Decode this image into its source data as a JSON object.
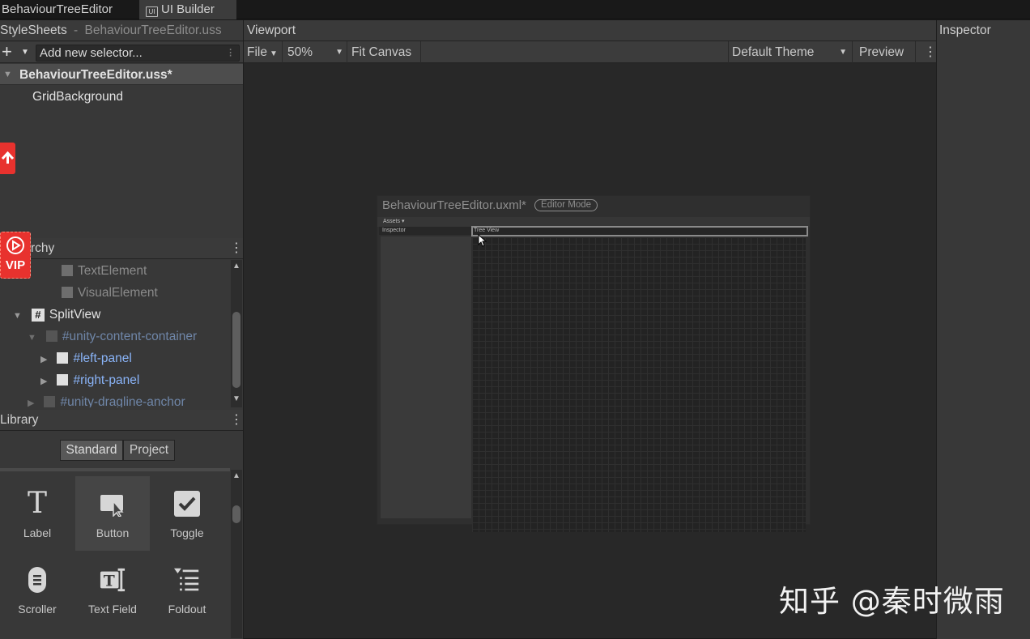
{
  "tabs": [
    {
      "label": "BehaviourTreeEditor"
    },
    {
      "label": "UI Builder",
      "icon": "ui-builder-icon",
      "icon_text": "UI"
    }
  ],
  "stylesheets": {
    "header_title": "StyleSheets",
    "header_sep": "-",
    "header_file": "BehaviourTreeEditor.uss",
    "add_glyph": "+",
    "selector_placeholder": "Add new selector...",
    "selector_menu": "⁝",
    "items": [
      {
        "label": "BehaviourTreeEditor.uss*"
      },
      {
        "label": "GridBackground"
      }
    ]
  },
  "hierarchy": {
    "title_visible": "rchy",
    "rows": [
      {
        "label": "TextElement"
      },
      {
        "label": "VisualElement"
      },
      {
        "label": "SplitView",
        "badge": "#"
      },
      {
        "label": "#unity-content-container"
      },
      {
        "label": "#left-panel"
      },
      {
        "label": "#right-panel"
      },
      {
        "label": "#unity-dragline-anchor"
      }
    ]
  },
  "library": {
    "title": "Library",
    "tabs": [
      {
        "label": "Standard"
      },
      {
        "label": "Project"
      }
    ],
    "items": [
      {
        "label": "Label",
        "icon": "label-icon",
        "glyph": "T"
      },
      {
        "label": "Button",
        "icon": "button-icon"
      },
      {
        "label": "Toggle",
        "icon": "toggle-icon"
      },
      {
        "label": "Scroller",
        "icon": "scroller-icon"
      },
      {
        "label": "Text Field",
        "icon": "text-field-icon",
        "glyph": "T"
      },
      {
        "label": "Foldout",
        "icon": "foldout-icon"
      }
    ]
  },
  "viewport": {
    "title": "Viewport",
    "file_menu": "File",
    "zoom": "50%",
    "fit_canvas": "Fit Canvas",
    "theme": "Default Theme",
    "preview": "Preview",
    "document": {
      "title": "BehaviourTreeEditor.uxml*",
      "mode_badge": "Editor Mode",
      "assets_menu": "Assets",
      "inspector_label": "Inspector",
      "tree_view_label": "Tree View"
    }
  },
  "inspector": {
    "title": "Inspector"
  },
  "overlay": {
    "vip_label": "VIP",
    "watermark": "知乎 @秦时微雨"
  },
  "colors": {
    "accent_red": "#e8322e",
    "link_blue": "#8ab4f8",
    "dim_blue": "#6f86a8"
  }
}
